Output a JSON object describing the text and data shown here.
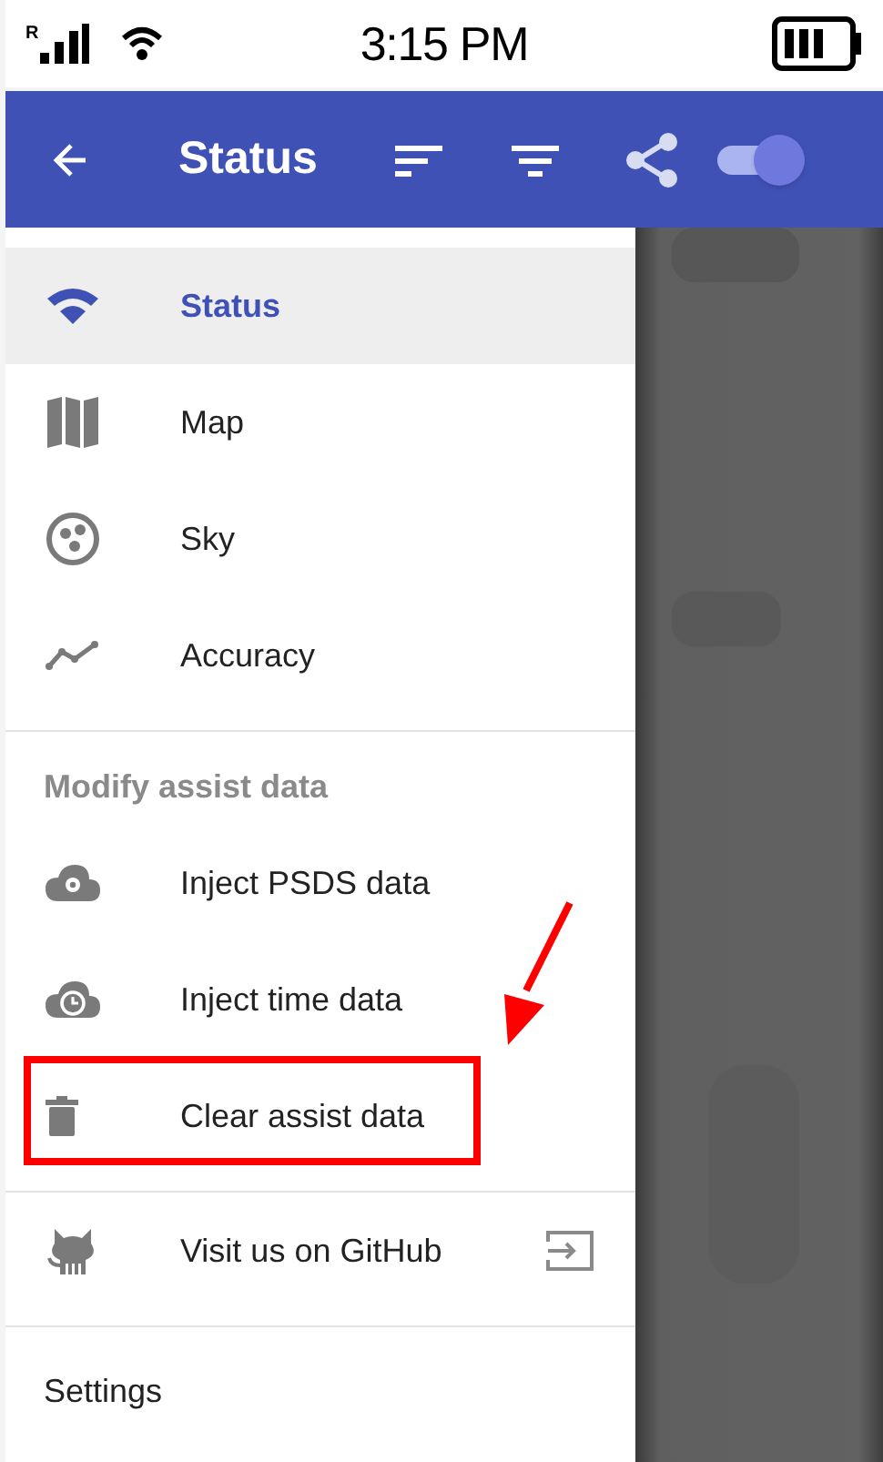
{
  "status_bar": {
    "time": "3:15 PM",
    "roaming": "R"
  },
  "app_bar": {
    "title": "Status",
    "toggle": {
      "on": true
    }
  },
  "drawer": {
    "sections": [
      {
        "items": [
          {
            "kind": "status",
            "label": "Status",
            "selected": true,
            "highlighted": false,
            "external": false
          },
          {
            "kind": "map",
            "label": "Map",
            "selected": false,
            "highlighted": false,
            "external": false
          },
          {
            "kind": "sky",
            "label": "Sky",
            "selected": false,
            "highlighted": false,
            "external": false
          },
          {
            "kind": "accuracy",
            "label": "Accuracy",
            "selected": false,
            "highlighted": false,
            "external": false
          }
        ]
      },
      {
        "header": "Modify assist data",
        "items": [
          {
            "kind": "psds",
            "label": "Inject PSDS data",
            "selected": false,
            "highlighted": false,
            "external": false
          },
          {
            "kind": "time",
            "label": "Inject time data",
            "selected": false,
            "highlighted": false,
            "external": false
          },
          {
            "kind": "clear",
            "label": "Clear assist data",
            "selected": false,
            "highlighted": true,
            "external": false
          }
        ]
      },
      {
        "items": [
          {
            "kind": "github",
            "label": "Visit us on GitHub",
            "selected": false,
            "highlighted": false,
            "external": true
          }
        ]
      },
      {
        "header": "Settings"
      }
    ]
  }
}
